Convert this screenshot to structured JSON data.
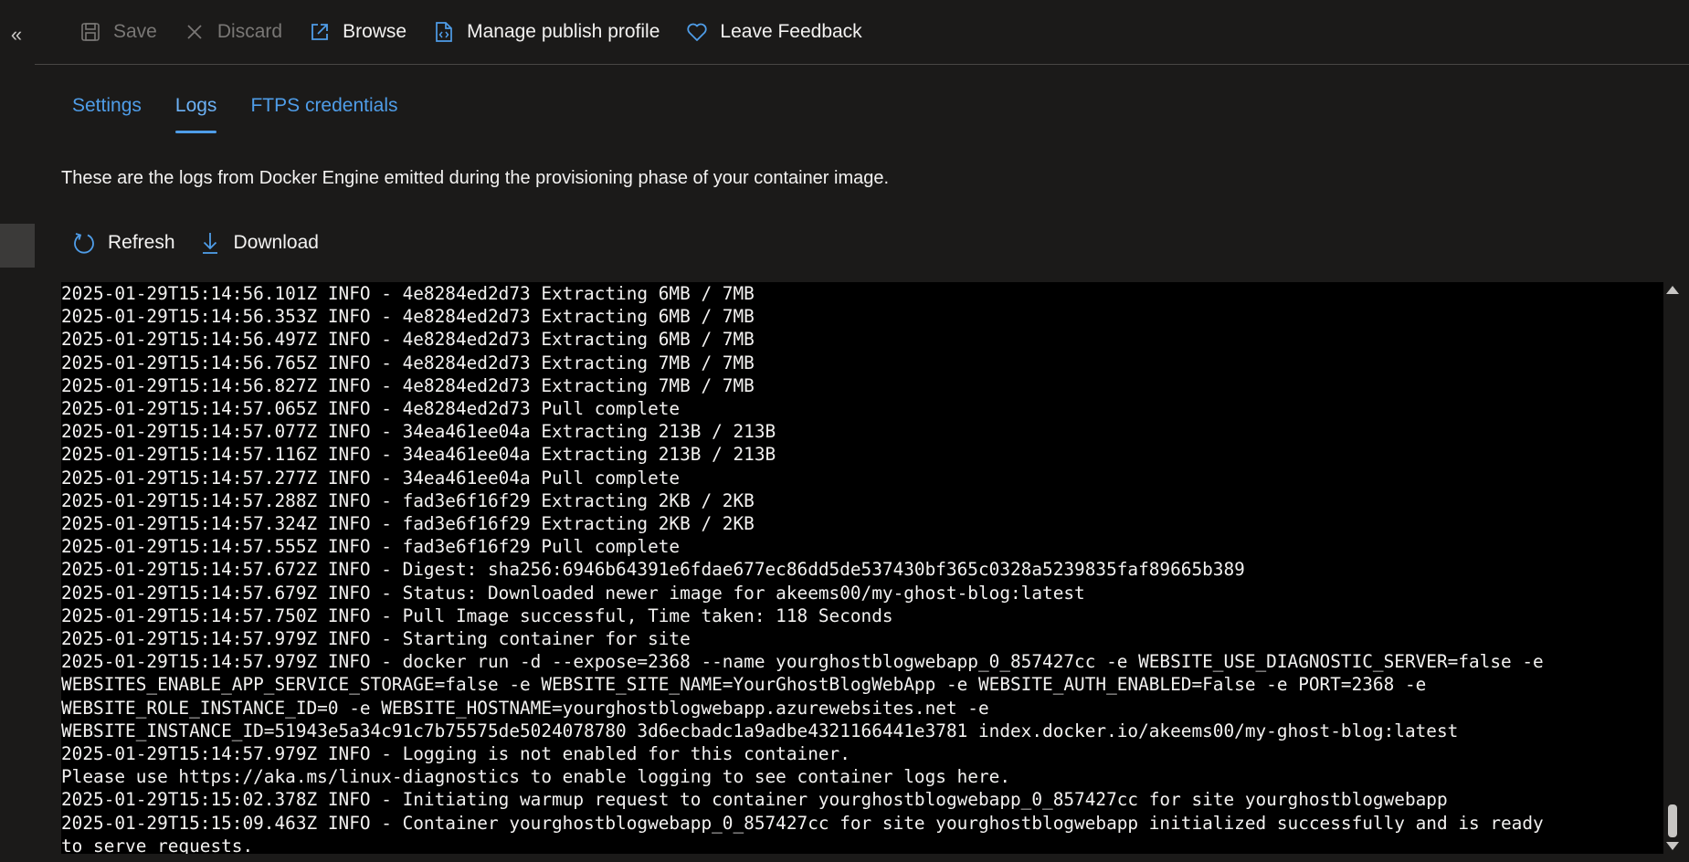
{
  "rail": {
    "collapse_label": "«"
  },
  "toolbar": {
    "save_label": "Save",
    "discard_label": "Discard",
    "browse_label": "Browse",
    "manage_label": "Manage publish profile",
    "feedback_label": "Leave Feedback"
  },
  "tabs": [
    {
      "label": "Settings",
      "active": false
    },
    {
      "label": "Logs",
      "active": true
    },
    {
      "label": "FTPS credentials",
      "active": false
    }
  ],
  "description": "These are the logs from Docker Engine emitted during the provisioning phase of your container image.",
  "actions": {
    "refresh_label": "Refresh",
    "download_label": "Download"
  },
  "logs": [
    "2025-01-29T15:14:56.101Z INFO - 4e8284ed2d73 Extracting 6MB / 7MB",
    "2025-01-29T15:14:56.353Z INFO - 4e8284ed2d73 Extracting 6MB / 7MB",
    "2025-01-29T15:14:56.497Z INFO - 4e8284ed2d73 Extracting 6MB / 7MB",
    "2025-01-29T15:14:56.765Z INFO - 4e8284ed2d73 Extracting 7MB / 7MB",
    "2025-01-29T15:14:56.827Z INFO - 4e8284ed2d73 Extracting 7MB / 7MB",
    "2025-01-29T15:14:57.065Z INFO - 4e8284ed2d73 Pull complete",
    "2025-01-29T15:14:57.077Z INFO - 34ea461ee04a Extracting 213B / 213B",
    "2025-01-29T15:14:57.116Z INFO - 34ea461ee04a Extracting 213B / 213B",
    "2025-01-29T15:14:57.277Z INFO - 34ea461ee04a Pull complete",
    "2025-01-29T15:14:57.288Z INFO - fad3e6f16f29 Extracting 2KB / 2KB",
    "2025-01-29T15:14:57.324Z INFO - fad3e6f16f29 Extracting 2KB / 2KB",
    "2025-01-29T15:14:57.555Z INFO - fad3e6f16f29 Pull complete",
    "2025-01-29T15:14:57.672Z INFO - Digest: sha256:6946b64391e6fdae677ec86dd5de537430bf365c0328a5239835faf89665b389",
    "2025-01-29T15:14:57.679Z INFO - Status: Downloaded newer image for akeems00/my-ghost-blog:latest",
    "2025-01-29T15:14:57.750Z INFO - Pull Image successful, Time taken: 118 Seconds",
    "2025-01-29T15:14:57.979Z INFO - Starting container for site",
    "2025-01-29T15:14:57.979Z INFO - docker run -d --expose=2368 --name yourghostblogwebapp_0_857427cc -e WEBSITE_USE_DIAGNOSTIC_SERVER=false -e",
    "WEBSITES_ENABLE_APP_SERVICE_STORAGE=false -e WEBSITE_SITE_NAME=YourGhostBlogWebApp -e WEBSITE_AUTH_ENABLED=False -e PORT=2368 -e",
    "WEBSITE_ROLE_INSTANCE_ID=0 -e WEBSITE_HOSTNAME=yourghostblogwebapp.azurewebsites.net -e",
    "WEBSITE_INSTANCE_ID=51943e5a34c91c7b75575de5024078780 3d6ecbadc1a9adbe4321166441e3781 index.docker.io/akeems00/my-ghost-blog:latest",
    "2025-01-29T15:14:57.979Z INFO - Logging is not enabled for this container.",
    "Please use https://aka.ms/linux-diagnostics to enable logging to see container logs here.",
    "2025-01-29T15:15:02.378Z INFO - Initiating warmup request to container yourghostblogwebapp_0_857427cc for site yourghostblogwebapp",
    "2025-01-29T15:15:09.463Z INFO - Container yourghostblogwebapp_0_857427cc for site yourghostblogwebapp initialized successfully and is ready",
    "to serve requests."
  ]
}
